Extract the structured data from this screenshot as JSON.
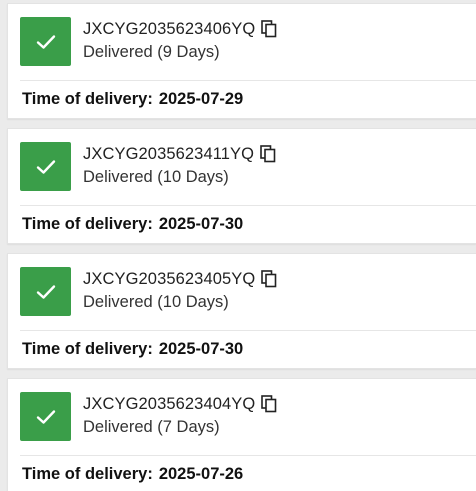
{
  "colors": {
    "status_green": "#3a9e49",
    "card_background": "#ffffff",
    "page_background": "#ebebeb"
  },
  "icons": {
    "status": "check-icon",
    "copy": "copy-icon"
  },
  "shipments": [
    {
      "tracking_number": "JXCYG2035623406YQ",
      "status": "Delivered (9 Days)",
      "delivery_label": "Time of delivery:",
      "delivery_date": "2025-07-29"
    },
    {
      "tracking_number": "JXCYG2035623411YQ",
      "status": "Delivered (10 Days)",
      "delivery_label": "Time of delivery:",
      "delivery_date": "2025-07-30"
    },
    {
      "tracking_number": "JXCYG2035623405YQ",
      "status": "Delivered (10 Days)",
      "delivery_label": "Time of delivery:",
      "delivery_date": "2025-07-30"
    },
    {
      "tracking_number": "JXCYG2035623404YQ",
      "status": "Delivered (7 Days)",
      "delivery_label": "Time of delivery:",
      "delivery_date": "2025-07-26"
    }
  ]
}
